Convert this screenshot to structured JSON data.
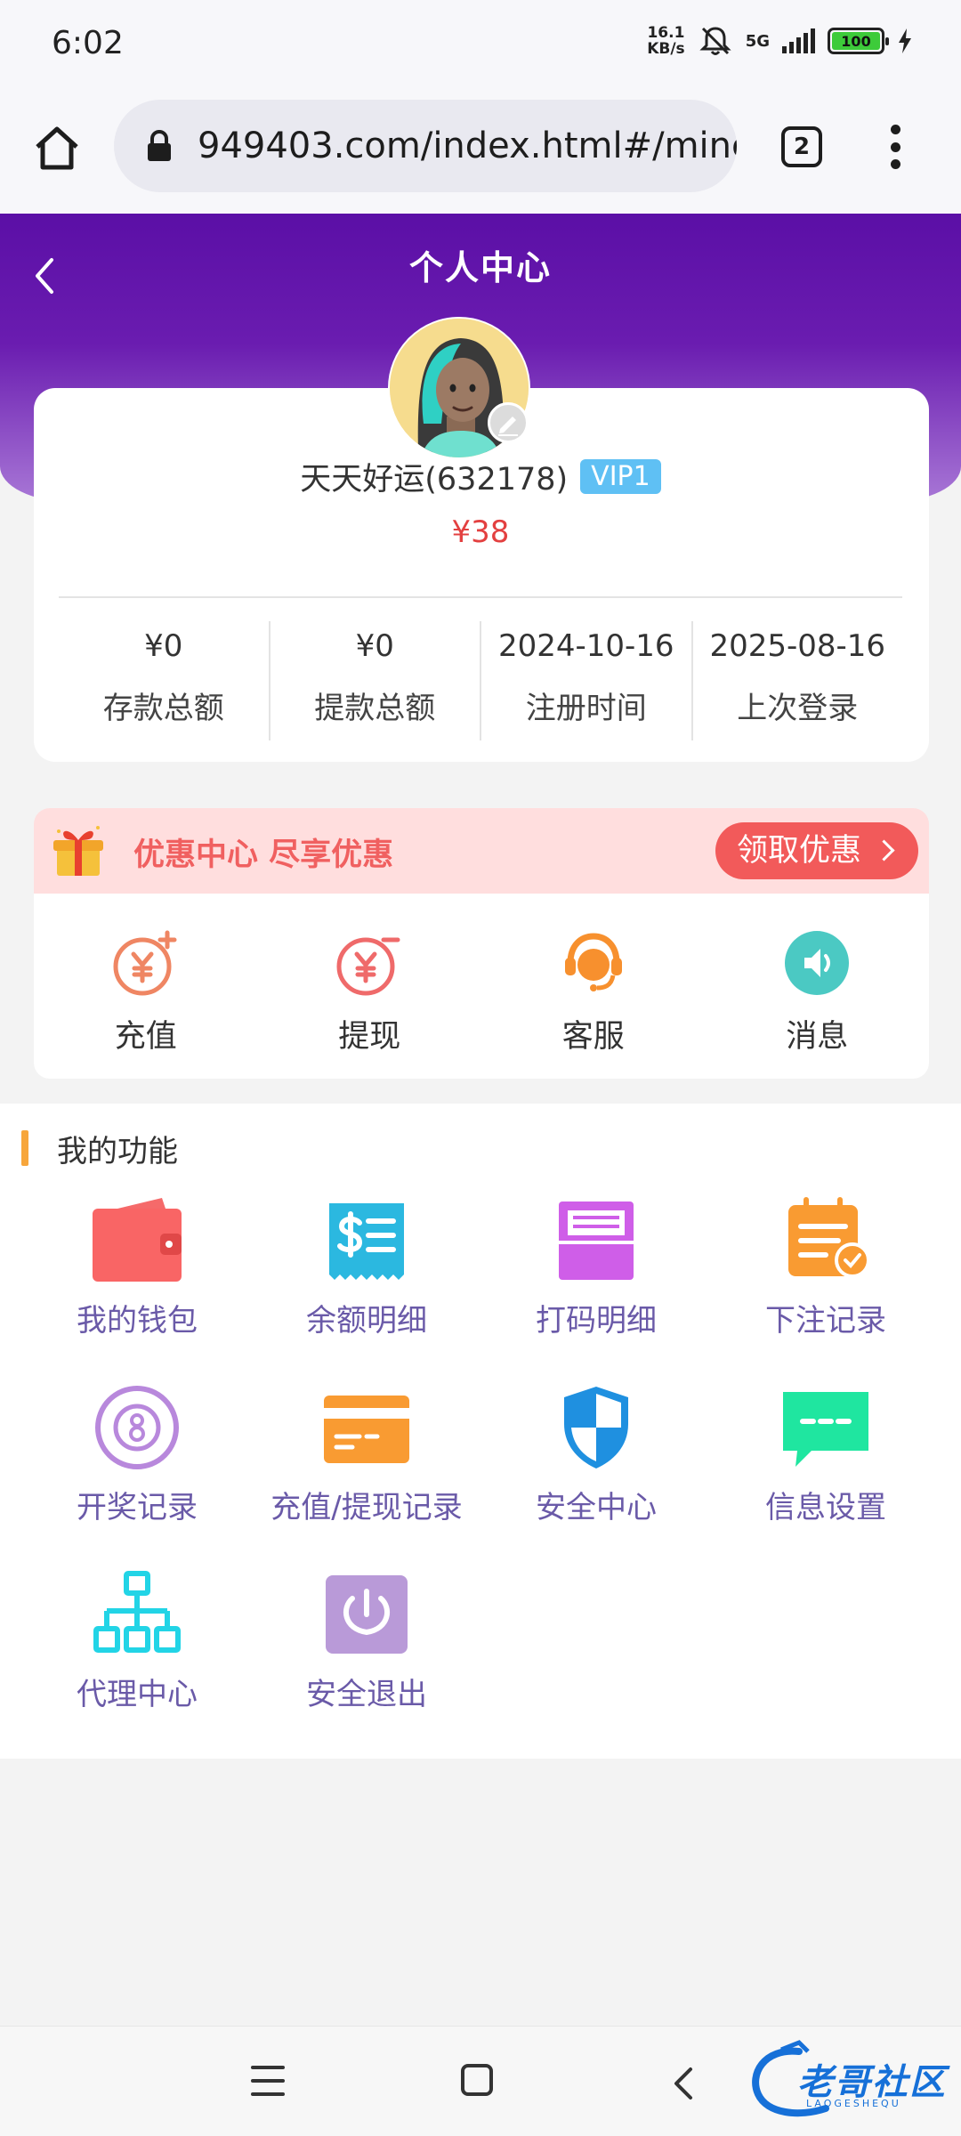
{
  "status_bar": {
    "time": "6:02",
    "net_speed_value": "16.1",
    "net_speed_unit": "KB/s",
    "network": "5G",
    "battery": "100"
  },
  "browser": {
    "url": "949403.com/index.html#/mine",
    "tab_count": "2"
  },
  "header": {
    "title": "个人中心"
  },
  "profile": {
    "name": "天天好运(632178)",
    "vip": "VIP1",
    "balance": "¥38",
    "stats": [
      {
        "value": "¥0",
        "label": "存款总额"
      },
      {
        "value": "¥0",
        "label": "提款总额"
      },
      {
        "value": "2024-10-16",
        "label": "注册时间"
      },
      {
        "value": "2025-08-16",
        "label": "上次登录"
      }
    ]
  },
  "promo": {
    "text": "优惠中心 尽享优惠",
    "button": "领取优惠"
  },
  "quick_actions": [
    {
      "label": "充值",
      "icon": "recharge-icon"
    },
    {
      "label": "提现",
      "icon": "withdraw-icon"
    },
    {
      "label": "客服",
      "icon": "customer-service-icon"
    },
    {
      "label": "消息",
      "icon": "message-icon"
    }
  ],
  "functions": {
    "title": "我的功能",
    "items": [
      {
        "label": "我的钱包",
        "icon": "wallet-icon"
      },
      {
        "label": "余额明细",
        "icon": "balance-detail-icon"
      },
      {
        "label": "打码明细",
        "icon": "betting-detail-icon"
      },
      {
        "label": "下注记录",
        "icon": "bet-record-icon"
      },
      {
        "label": "开奖记录",
        "icon": "lottery-record-icon"
      },
      {
        "label": "充值/提现记录",
        "icon": "card-record-icon"
      },
      {
        "label": "安全中心",
        "icon": "shield-icon"
      },
      {
        "label": "信息设置",
        "icon": "chat-settings-icon"
      },
      {
        "label": "代理中心",
        "icon": "org-chart-icon"
      },
      {
        "label": "安全退出",
        "icon": "power-icon"
      }
    ]
  },
  "watermark": {
    "text": "老哥社区",
    "sub": "LAOGESHEQU"
  },
  "colors": {
    "header_purple": "#5b0fa6",
    "balance_red": "#e34040",
    "promo_red": "#f25a5a",
    "function_label": "#6a5aa8",
    "accent_orange": "#f7a63b"
  }
}
